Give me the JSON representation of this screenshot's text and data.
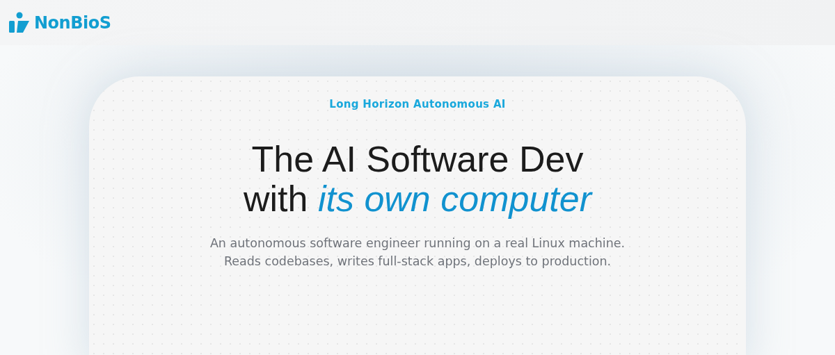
{
  "header": {
    "logo_text": "NonBioS"
  },
  "hero": {
    "eyebrow": "Long Horizon Autonomous AI",
    "headline_lines": [
      "The AI Software Dev",
      "with *its own computer*"
    ],
    "subtitle_lines": [
      "An autonomous software engineer running on a real Linux machine.",
      "Reads codebases, writes full-stack apps, deploys to production."
    ]
  }
}
